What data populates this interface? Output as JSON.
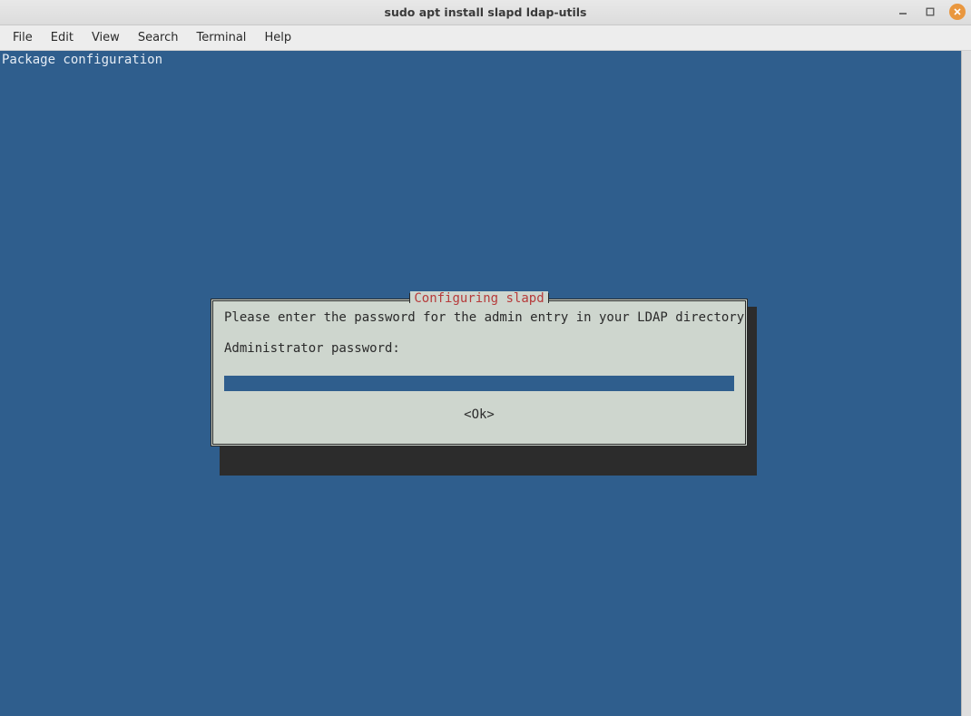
{
  "window": {
    "title": "sudo apt install slapd ldap-utils"
  },
  "menu": {
    "file": "File",
    "edit": "Edit",
    "view": "View",
    "search": "Search",
    "terminal": "Terminal",
    "help": "Help"
  },
  "terminal": {
    "top_line": "Package configuration"
  },
  "dialog": {
    "title": "Configuring slapd",
    "message": "Please enter the password for the admin entry in your LDAP directory.",
    "label": "Administrator password:",
    "input_value": "",
    "ok_label": "<Ok>"
  }
}
